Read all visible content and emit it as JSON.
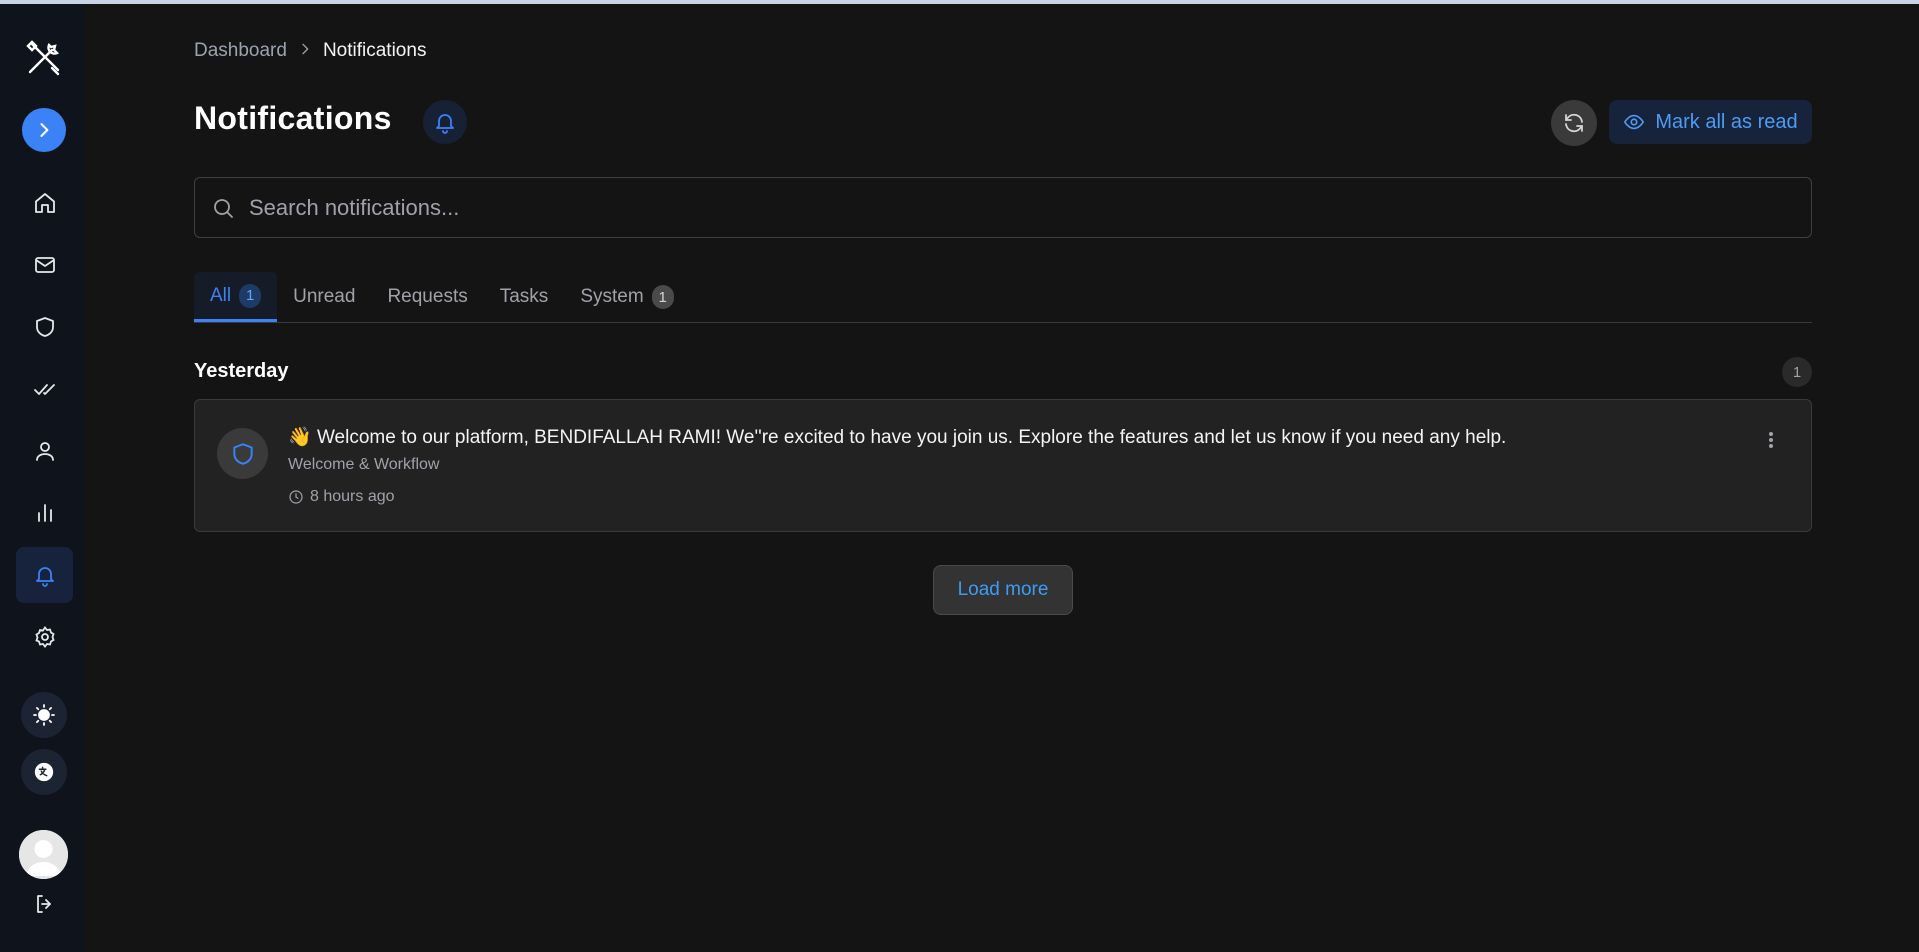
{
  "breadcrumb": {
    "parent": "Dashboard",
    "separator": ">",
    "current": "Notifications"
  },
  "page": {
    "title": "Notifications"
  },
  "header_actions": {
    "mark_all_read": "Mark all as read"
  },
  "search": {
    "placeholder": "Search notifications..."
  },
  "tabs": [
    {
      "label": "All",
      "badge": "1",
      "active": true
    },
    {
      "label": "Unread"
    },
    {
      "label": "Requests"
    },
    {
      "label": "Tasks"
    },
    {
      "label": "System",
      "badge": "1"
    }
  ],
  "groups": [
    {
      "label": "Yesterday",
      "count": "1",
      "items": [
        {
          "emoji": "👋",
          "message": "Welcome to our platform, BENDIFALLAH RAMI! We''re excited to have you join us. Explore the features and let us know if you need any help.",
          "category": "Welcome & Workflow",
          "time": "8 hours ago",
          "icon": "shield-icon"
        }
      ]
    }
  ],
  "footer": {
    "load_more": "Load more"
  },
  "sidebar": {
    "items": [
      {
        "icon": "home-icon"
      },
      {
        "icon": "mail-icon"
      },
      {
        "icon": "shield-icon"
      },
      {
        "icon": "double-check-icon"
      },
      {
        "icon": "user-icon"
      },
      {
        "icon": "bar-chart-icon"
      },
      {
        "icon": "bell-icon",
        "active": true
      },
      {
        "icon": "gear-icon"
      }
    ]
  },
  "colors": {
    "accent": "#3b82f6",
    "background": "#141414",
    "sidebar": "#0f141c"
  }
}
